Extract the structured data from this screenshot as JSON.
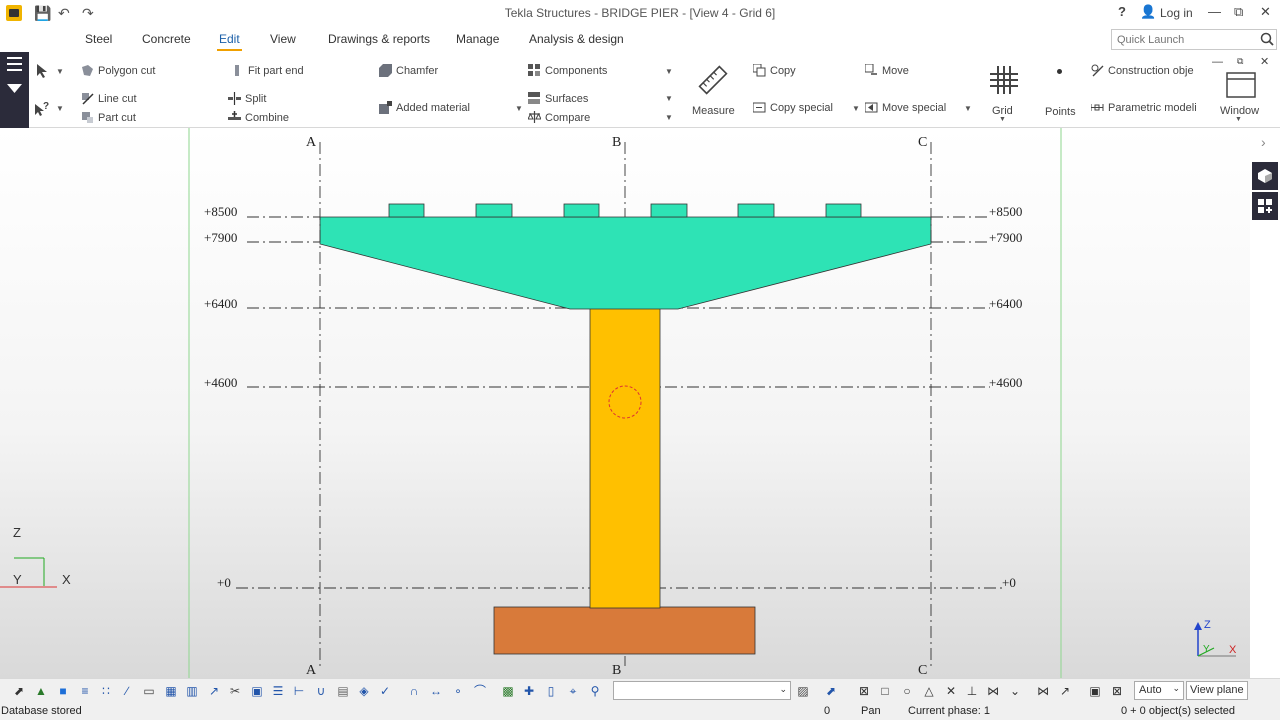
{
  "window": {
    "title": "Tekla Structures - BRIDGE PIER - [View 4 - Grid 6]",
    "help": "?",
    "login": "Log in"
  },
  "tabs": [
    {
      "label": "Steel"
    },
    {
      "label": "Concrete"
    },
    {
      "label": "Edit",
      "active": true
    },
    {
      "label": "View"
    },
    {
      "label": "Drawings & reports"
    },
    {
      "label": "Manage"
    },
    {
      "label": "Analysis & design"
    }
  ],
  "quick_launch": {
    "placeholder": "Quick Launch"
  },
  "ribbon": {
    "polygon_cut": "Polygon cut",
    "line_cut": "Line cut",
    "part_cut": "Part cut",
    "fit_part_end": "Fit part end",
    "split": "Split",
    "combine": "Combine",
    "chamfer": "Chamfer",
    "added_material": "Added material",
    "components": "Components",
    "surfaces": "Surfaces",
    "compare": "Compare",
    "measure": "Measure",
    "copy": "Copy",
    "copy_special": "Copy special",
    "move": "Move",
    "move_special": "Move special",
    "grid": "Grid",
    "points": "Points",
    "construction_objects": "Construction obje",
    "parametric_modeling": "Parametric modeli",
    "window": "Window"
  },
  "drawing": {
    "grid_labels_top": [
      "A",
      "B",
      "C"
    ],
    "grid_labels_bottom": [
      "A",
      "B",
      "C"
    ],
    "levels_left": [
      "+8500",
      "+7900",
      "+6400",
      "+4600",
      "+0"
    ],
    "levels_right": [
      "+8500",
      "+7900",
      "+6400",
      "+4600",
      "+0"
    ],
    "axis_z": "Z",
    "axis_y": "Y",
    "axis_x": "X",
    "colors": {
      "pier_cap": "#2ee3b5",
      "column": "#ffc000",
      "footing": "#d87a3a",
      "gridline": "#333333"
    }
  },
  "bottom_toolbar": {
    "auto": "Auto",
    "view_plane": "View plane"
  },
  "status": {
    "message": "Database stored",
    "count": "0",
    "mode": "Pan",
    "phase": "Current phase: 1",
    "selected": "0 + 0 object(s) selected"
  }
}
